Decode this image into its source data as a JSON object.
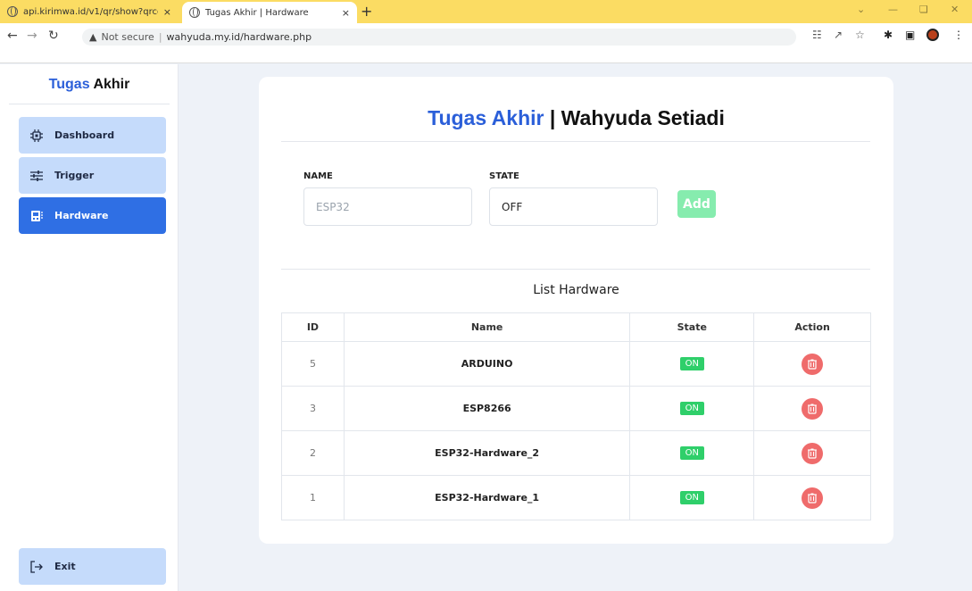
{
  "browser": {
    "tabs": [
      {
        "title": "api.kirimwa.id/v1/qr/show?qrcod",
        "close": "×"
      },
      {
        "title": "Tugas Akhir | Hardware",
        "close": "×"
      }
    ],
    "new_tab": "+",
    "security_label": "Not secure",
    "url": "wahyuda.my.id/hardware.php"
  },
  "sidebar": {
    "brand_accent": "Tugas",
    "brand_rest": " Akhir",
    "items": [
      {
        "label": "Dashboard",
        "icon": "chip-icon"
      },
      {
        "label": "Trigger",
        "icon": "sliders-icon"
      },
      {
        "label": "Hardware",
        "icon": "board-icon",
        "active": true
      }
    ],
    "exit_label": "Exit"
  },
  "main": {
    "title_accent": "Tugas Akhir",
    "title_rest": " | Wahyuda Setiadi",
    "form": {
      "name_label": "NAME",
      "name_placeholder": "ESP32",
      "state_label": "STATE",
      "state_value": "OFF",
      "add_label": "Add"
    },
    "list_title": "List Hardware",
    "table": {
      "headers": [
        "ID",
        "Name",
        "State",
        "Action"
      ],
      "rows": [
        {
          "id": "5",
          "name": "ARDUINO",
          "state": "ON"
        },
        {
          "id": "3",
          "name": "ESP8266",
          "state": "ON"
        },
        {
          "id": "2",
          "name": "ESP32-Hardware_2",
          "state": "ON"
        },
        {
          "id": "1",
          "name": "ESP32-Hardware_1",
          "state": "ON"
        }
      ]
    }
  },
  "colors": {
    "accent": "#2b5fd9",
    "active_nav": "#2f6fe4",
    "nav": "#c5dbfb",
    "badge_on": "#2fcf6a",
    "delete": "#ef6b6b",
    "add_button": "#86ecae"
  }
}
